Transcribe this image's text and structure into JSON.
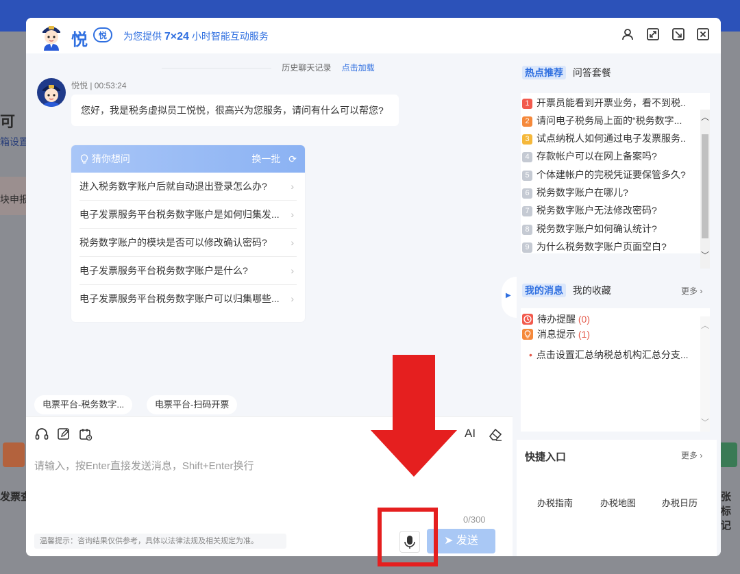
{
  "background": {
    "left_text_1": "可",
    "left_text_2": "箱设置",
    "left_text_3": "块申报",
    "left_text_4": "发票查",
    "right_text_1": "张标记"
  },
  "header": {
    "logo_text": "悦",
    "logo_badge": "悦",
    "tagline_prefix": "为您提供 ",
    "tagline_hours": "7×24",
    "tagline_suffix": " 小时智能互动服务",
    "icons": [
      "user-icon",
      "expand-icon",
      "minimize-icon",
      "close-icon"
    ]
  },
  "chat": {
    "history_label": "历史聊天记录",
    "history_load": "点击加载",
    "bot_meta": "悦悦 | 00:53:24",
    "greeting": "您好，我是税务虚拟员工悦悦，很高兴为您服务，请问有什么可以帮您?",
    "guess": {
      "title": "猜你想问",
      "refresh": "换一批",
      "items": [
        "进入税务数字账户后就自动退出登录怎么办?",
        "电子发票服务平台税务数字账户是如何归集发...",
        "税务数字账户的模块是否可以修改确认密码?",
        "电子发票服务平台税务数字账户是什么?",
        "电子发票服务平台税务数字账户可以归集哪些..."
      ]
    },
    "chips": [
      "电票平台-税务数字...",
      "电票平台-扫码开票"
    ]
  },
  "input": {
    "placeholder": "请输入，按Enter直接发送消息，Shift+Enter换行",
    "counter": "0/300",
    "tips": "温馨提示：咨询结果仅供参考，具体以法律法规及相关规定为准。",
    "send_label": "发送",
    "ai_label": "AI"
  },
  "right": {
    "hot_tab": "热点推荐",
    "qa_tab": "问答套餐",
    "hot_items": [
      {
        "num": "1",
        "text": "开票员能看到开票业务，看不到税...",
        "color": "#f25a4d"
      },
      {
        "num": "2",
        "text": "请问电子税务局上面的“税务数字...",
        "color": "#f5893b"
      },
      {
        "num": "3",
        "text": "试点纳税人如何通过电子发票服务...",
        "color": "#f5b83b"
      },
      {
        "num": "4",
        "text": "存款帐户可以在网上备案吗?",
        "color": "#c5cad3"
      },
      {
        "num": "5",
        "text": "个体建帐户的完税凭证要保管多久?",
        "color": "#c5cad3"
      },
      {
        "num": "6",
        "text": "税务数字账户在哪儿?",
        "color": "#c5cad3"
      },
      {
        "num": "7",
        "text": "税务数字账户无法修改密码?",
        "color": "#c5cad3"
      },
      {
        "num": "8",
        "text": "税务数字账户如何确认统计?",
        "color": "#c5cad3"
      },
      {
        "num": "9",
        "text": "为什么税务数字账户页面空白?",
        "color": "#c5cad3"
      }
    ],
    "msg_tab": "我的消息",
    "fav_tab": "我的收藏",
    "more": "更多",
    "todo_label": "待办提醒",
    "todo_count": "(0)",
    "notice_label": "消息提示",
    "notice_count": "(1)",
    "notice_item": "点击设置汇总纳税总机构汇总分支...",
    "quick_title": "快捷入口",
    "quick_more": "更多",
    "quick_links": [
      "办税指南",
      "办税地图",
      "办税日历"
    ]
  },
  "colors": {
    "accent": "#2f6fe0",
    "annotation": "#e51f1f"
  }
}
